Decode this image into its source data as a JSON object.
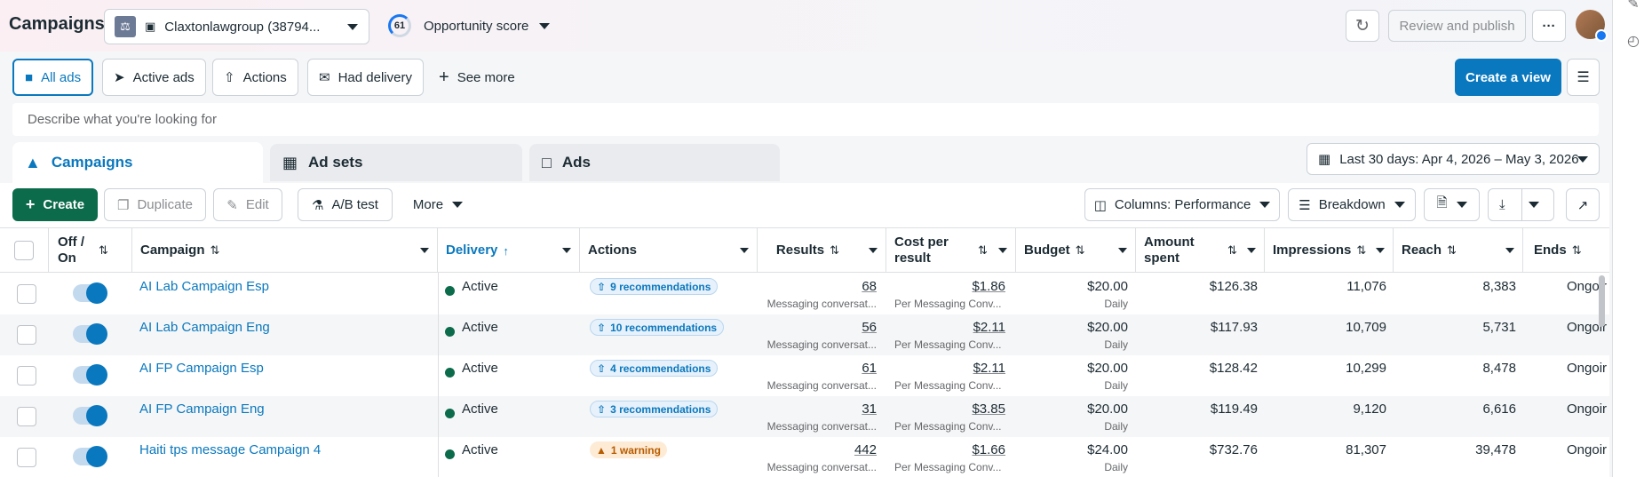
{
  "header": {
    "title": "Campaigns",
    "account_name": "Claxtonlawgroup (38794...",
    "opportunity_score": "61",
    "opportunity_label": "Opportunity score",
    "review_publish": "Review and publish",
    "more_glyph": "···"
  },
  "filters": {
    "all_ads": "All ads",
    "active_ads": "Active ads",
    "actions": "Actions",
    "had_delivery": "Had delivery",
    "see_more": "See more",
    "create_view": "Create a view"
  },
  "search": {
    "placeholder": "Describe what you're looking for"
  },
  "tabs": {
    "campaigns": "Campaigns",
    "ad_sets": "Ad sets",
    "ads": "Ads"
  },
  "date_range": "Last 30 days: Apr 4, 2026 – May 3, 2026",
  "toolbar": {
    "create": "Create",
    "duplicate": "Duplicate",
    "edit": "Edit",
    "ab_test": "A/B test",
    "more": "More",
    "columns": "Columns: Performance",
    "breakdown": "Breakdown"
  },
  "columns": {
    "off_on": "Off / On",
    "campaign": "Campaign",
    "delivery": "Delivery",
    "actions": "Actions",
    "results": "Results",
    "cost_per_result": "Cost per result",
    "budget": "Budget",
    "amount_spent": "Amount spent",
    "impressions": "Impressions",
    "reach": "Reach",
    "ends": "Ends"
  },
  "rows": [
    {
      "name": "AI Lab Campaign Esp",
      "delivery": "Active",
      "action": "9 recommendations",
      "action_type": "rec",
      "results": "68",
      "results_sub": "Messaging conversat...",
      "cpr": "$1.86",
      "cpr_sub": "Per Messaging Conv...",
      "budget": "$20.00",
      "budget_sub": "Daily",
      "spent": "$126.38",
      "impressions": "11,076",
      "reach": "8,383",
      "ends": "Ongoir"
    },
    {
      "name": "AI Lab Campaign Eng",
      "delivery": "Active",
      "action": "10 recommendations",
      "action_type": "rec",
      "results": "56",
      "results_sub": "Messaging conversat...",
      "cpr": "$2.11",
      "cpr_sub": "Per Messaging Conv...",
      "budget": "$20.00",
      "budget_sub": "Daily",
      "spent": "$117.93",
      "impressions": "10,709",
      "reach": "5,731",
      "ends": "Ongoir"
    },
    {
      "name": "AI FP Campaign Esp",
      "delivery": "Active",
      "action": "4 recommendations",
      "action_type": "rec",
      "results": "61",
      "results_sub": "Messaging conversat...",
      "cpr": "$2.11",
      "cpr_sub": "Per Messaging Conv...",
      "budget": "$20.00",
      "budget_sub": "Daily",
      "spent": "$128.42",
      "impressions": "10,299",
      "reach": "8,478",
      "ends": "Ongoir"
    },
    {
      "name": "AI FP Campaign Eng",
      "delivery": "Active",
      "action": "3 recommendations",
      "action_type": "rec",
      "results": "31",
      "results_sub": "Messaging conversat...",
      "cpr": "$3.85",
      "cpr_sub": "Per Messaging Conv...",
      "budget": "$20.00",
      "budget_sub": "Daily",
      "spent": "$119.49",
      "impressions": "9,120",
      "reach": "6,616",
      "ends": "Ongoir"
    },
    {
      "name": "Haiti tps message Campaign 4",
      "delivery": "Active",
      "action": "1 warning",
      "action_type": "warn",
      "results": "442",
      "results_sub": "Messaging conversat...",
      "cpr": "$1.66",
      "cpr_sub": "Per Messaging Conv...",
      "budget": "$24.00",
      "budget_sub": "Daily",
      "spent": "$732.76",
      "impressions": "81,307",
      "reach": "39,478",
      "ends": "Ongoir"
    }
  ],
  "colors": {
    "accent": "#0a78be",
    "create": "#0b6b4b",
    "warning": "#b85c00"
  }
}
